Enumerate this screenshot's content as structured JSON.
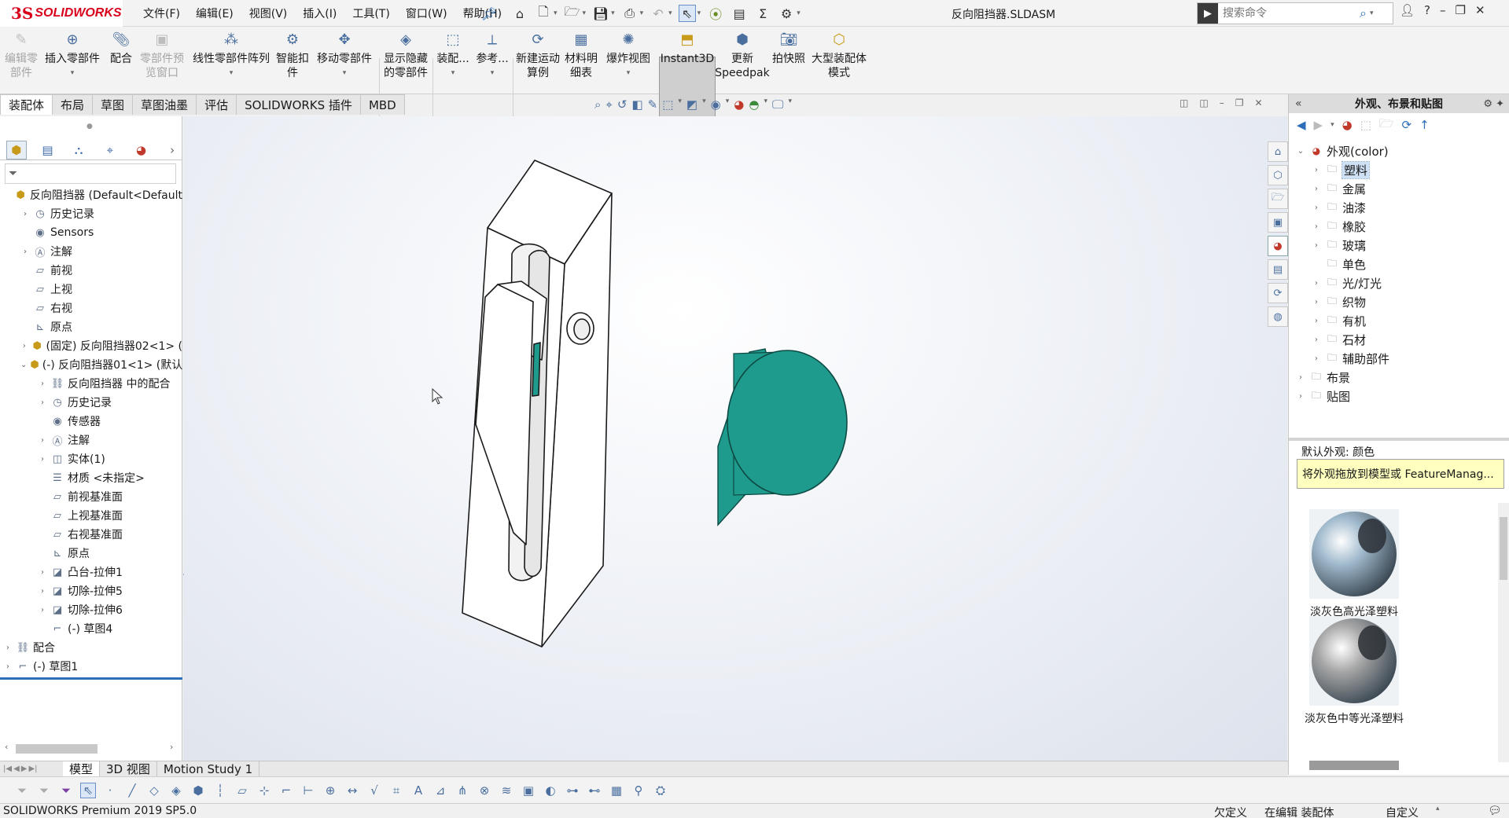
{
  "app": {
    "logo_prefix": "3S",
    "logo_name": "SOLIDWORKS",
    "document_title": "反向阻挡器.SLDASM"
  },
  "menu": [
    "文件(F)",
    "编辑(E)",
    "视图(V)",
    "插入(I)",
    "工具(T)",
    "窗口(W)",
    "帮助(H)"
  ],
  "search": {
    "placeholder": "搜索命令"
  },
  "commands": {
    "edit_part": "编辑零部件",
    "insert_part": "插入零部件",
    "mate": "配合",
    "part_preview": "零部件预览窗口",
    "linear_pattern": "线性零部件阵列",
    "smart_fastener": "智能扣件",
    "move_part": "移动零部件",
    "show_hidden": "显示隐藏的零部件",
    "assembly": "装配...",
    "reference": "参考...",
    "new_motion": "新建运动算例",
    "bom": "材料明细表",
    "explode": "爆炸视图",
    "instant3d": "Instant3D",
    "speedpak_1": "更新",
    "speedpak_2": "Speedpak",
    "snapshot": "拍快照",
    "large_assembly": "大型装配体模式"
  },
  "tabs": [
    "装配体",
    "布局",
    "草图",
    "草图油墨",
    "评估",
    "SOLIDWORKS 插件",
    "MBD"
  ],
  "tree": [
    {
      "label": "反向阻挡器  (Default<Default",
      "level": 0,
      "arrow": "",
      "icon": "assembly"
    },
    {
      "label": "历史记录",
      "level": 1,
      "arrow": "›",
      "icon": "history"
    },
    {
      "label": "Sensors",
      "level": 1,
      "arrow": "",
      "icon": "sensor"
    },
    {
      "label": "注解",
      "level": 1,
      "arrow": "›",
      "icon": "annotation"
    },
    {
      "label": "前视",
      "level": 1,
      "arrow": "",
      "icon": "plane"
    },
    {
      "label": "上视",
      "level": 1,
      "arrow": "",
      "icon": "plane"
    },
    {
      "label": "右视",
      "level": 1,
      "arrow": "",
      "icon": "plane"
    },
    {
      "label": "原点",
      "level": 1,
      "arrow": "",
      "icon": "origin"
    },
    {
      "label": "(固定) 反向阻挡器02<1> (",
      "level": 1,
      "arrow": "›",
      "icon": "part"
    },
    {
      "label": "(-) 反向阻挡器01<1> (默认",
      "level": 1,
      "arrow": "⌄",
      "icon": "part"
    },
    {
      "label": "反向阻挡器 中的配合",
      "level": 2,
      "arrow": "›",
      "icon": "mates"
    },
    {
      "label": "历史记录",
      "level": 2,
      "arrow": "›",
      "icon": "history"
    },
    {
      "label": "传感器",
      "level": 2,
      "arrow": "",
      "icon": "sensor"
    },
    {
      "label": "注解",
      "level": 2,
      "arrow": "›",
      "icon": "annotation"
    },
    {
      "label": "实体(1)",
      "level": 2,
      "arrow": "›",
      "icon": "solid"
    },
    {
      "label": "材质 <未指定>",
      "level": 2,
      "arrow": "",
      "icon": "material"
    },
    {
      "label": "前视基准面",
      "level": 2,
      "arrow": "",
      "icon": "plane"
    },
    {
      "label": "上视基准面",
      "level": 2,
      "arrow": "",
      "icon": "plane"
    },
    {
      "label": "右视基准面",
      "level": 2,
      "arrow": "",
      "icon": "plane"
    },
    {
      "label": "原点",
      "level": 2,
      "arrow": "",
      "icon": "origin"
    },
    {
      "label": "凸台-拉伸1",
      "level": 2,
      "arrow": "›",
      "icon": "extrude"
    },
    {
      "label": "切除-拉伸5",
      "level": 2,
      "arrow": "›",
      "icon": "extrude"
    },
    {
      "label": "切除-拉伸6",
      "level": 2,
      "arrow": "›",
      "icon": "extrude"
    },
    {
      "label": "(-) 草图4",
      "level": 2,
      "arrow": "",
      "icon": "sketch"
    },
    {
      "label": "配合",
      "level": 0,
      "arrow": "›",
      "icon": "mates"
    },
    {
      "label": "(-) 草图1",
      "level": 0,
      "arrow": "›",
      "icon": "sketch"
    }
  ],
  "right_panel": {
    "title": "外观、布景和贴图",
    "tree": [
      {
        "label": "外观(color)",
        "level": 0,
        "arrow": "⌄",
        "selected": false
      },
      {
        "label": "塑料",
        "level": 1,
        "arrow": "›",
        "selected": true
      },
      {
        "label": "金属",
        "level": 1,
        "arrow": "›",
        "selected": false
      },
      {
        "label": "油漆",
        "level": 1,
        "arrow": "›",
        "selected": false
      },
      {
        "label": "橡胶",
        "level": 1,
        "arrow": "›",
        "selected": false
      },
      {
        "label": "玻璃",
        "level": 1,
        "arrow": "›",
        "selected": false
      },
      {
        "label": "单色",
        "level": 1,
        "arrow": "",
        "selected": false
      },
      {
        "label": "光/灯光",
        "level": 1,
        "arrow": "›",
        "selected": false
      },
      {
        "label": "织物",
        "level": 1,
        "arrow": "›",
        "selected": false
      },
      {
        "label": "有机",
        "level": 1,
        "arrow": "›",
        "selected": false
      },
      {
        "label": "石材",
        "level": 1,
        "arrow": "›",
        "selected": false
      },
      {
        "label": "辅助部件",
        "level": 1,
        "arrow": "›",
        "selected": false
      },
      {
        "label": "布景",
        "level": 0,
        "arrow": "›",
        "selected": false
      },
      {
        "label": "贴图",
        "level": 0,
        "arrow": "›",
        "selected": false
      }
    ],
    "default_appearance": "默认外观: 颜色",
    "tooltip": "将外观拖放到模型或 FeatureManag...",
    "swatches": [
      {
        "label": "淡灰色高光泽塑料",
        "color": "#9fb9cc"
      },
      {
        "label": "淡灰色中等光泽塑料",
        "color": "#a6a6a6"
      }
    ]
  },
  "bottom_tabs": [
    "模型",
    "3D 视图",
    "Motion Study 1"
  ],
  "status": {
    "product": "SOLIDWORKS Premium 2019 SP5.0",
    "constraint": "欠定义",
    "editing": "在编辑 装配体",
    "custom": "自定义"
  },
  "colors": {
    "accent_red": "#d9001b",
    "cylinder_teal": "#1e9b8c",
    "tooltip_yellow": "#ffffbf"
  }
}
